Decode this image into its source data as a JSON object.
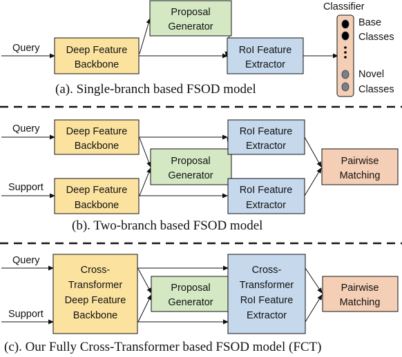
{
  "colors": {
    "backbone": "#fbe39f",
    "proposal": "#d4e8c4",
    "roi": "#c5d8ec",
    "matching": "#f4cfb5",
    "classifier": "#f4cfb5",
    "base_class_dot": "#000000",
    "novel_class_dot": "#7f7f7f",
    "stroke": "#111111"
  },
  "panels": {
    "a": {
      "caption": "(a). Single-branch based FSOD model",
      "inputs": {
        "query": "Query"
      },
      "backbone": [
        "Deep Feature",
        "Backbone"
      ],
      "proposal": [
        "Proposal",
        "Generator"
      ],
      "roi": [
        "RoI Feature",
        "Extractor"
      ],
      "classifier": {
        "title": "Classifier",
        "base_label": [
          "Base",
          "Classes"
        ],
        "novel_label": [
          "Novel",
          "Classes"
        ]
      }
    },
    "b": {
      "caption": "(b). Two-branch based FSOD model",
      "inputs": {
        "query": "Query",
        "support": "Support"
      },
      "backbone_query": [
        "Deep Feature",
        "Backbone"
      ],
      "backbone_support": [
        "Deep Feature",
        "Backbone"
      ],
      "proposal": [
        "Proposal",
        "Generator"
      ],
      "roi_query": [
        "RoI Feature",
        "Extractor"
      ],
      "roi_support": [
        "RoI Feature",
        "Extractor"
      ],
      "matching": [
        "Pairwise",
        "Matching"
      ]
    },
    "c": {
      "caption": "(c). Our Fully Cross-Transformer based FSOD model (FCT)",
      "inputs": {
        "query": "Query",
        "support": "Support"
      },
      "backbone": [
        "Cross-",
        "Transformer",
        "Deep Feature",
        "Backbone"
      ],
      "proposal": [
        "Proposal",
        "Generator"
      ],
      "roi": [
        "Cross-",
        "Transformer",
        "RoI Feature",
        "Extractor"
      ],
      "matching": [
        "Pairwise",
        "Matching"
      ]
    }
  }
}
